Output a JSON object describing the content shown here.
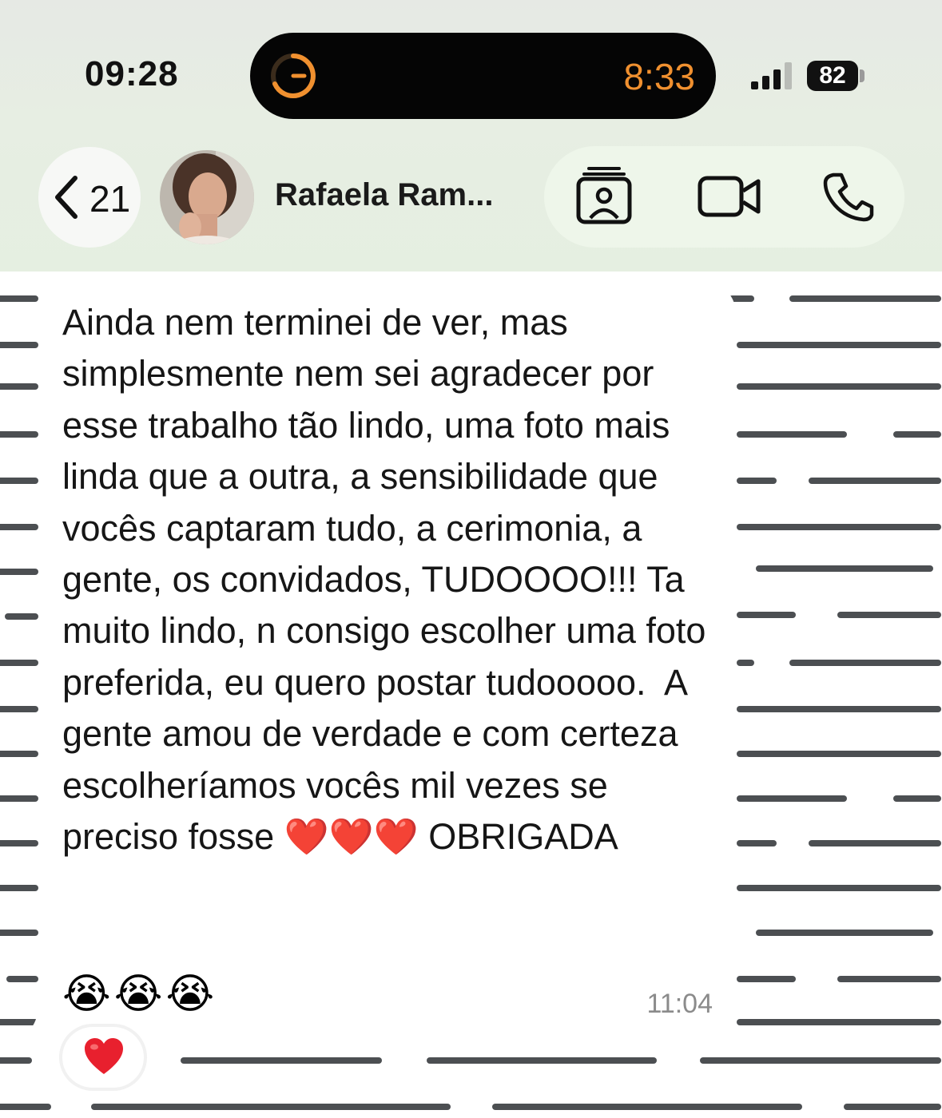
{
  "status_bar": {
    "time": "09:28",
    "island_timer": "8:33",
    "battery": "82"
  },
  "nav": {
    "back_count": "21",
    "contact_name": "Rafaela Ram..."
  },
  "message": {
    "text": "Ainda nem terminei de ver, mas simplesmente nem sei agradecer por esse trabalho tão lindo, uma foto mais linda que a outra, a sensibilidade que vocês captaram tudo, a cerimonia, a gente, os convidados, TUDOOOO!!! Ta muito lindo, n consigo escolher uma foto preferida, eu quero postar tudooooo.  A gente amou de verdade e com certeza escolheríamos vocês mil vezes se preciso fosse ❤️❤️❤️ OBRIGADA",
    "emojis": "😭😭😭",
    "time": "11:04",
    "reaction": "❤️"
  },
  "colors": {
    "header_bg": "#e6efe2",
    "island_accent": "#f0902f",
    "wallpaper_stripe": "#4c4f52"
  },
  "icons": [
    "chevron-left-icon",
    "timer-ring-icon",
    "signal-bars-icon",
    "contact-card-icon",
    "video-camera-icon",
    "phone-icon",
    "heart-icon"
  ]
}
